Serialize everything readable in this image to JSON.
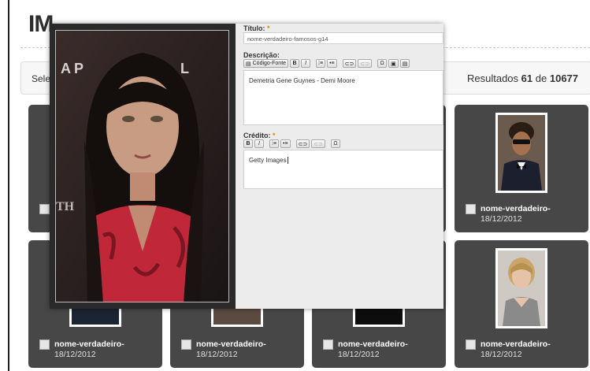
{
  "page": {
    "title": "IM",
    "select_label": "Sele",
    "results_prefix": "Resultados",
    "results_count": "61",
    "results_sep": "de",
    "results_total": "10677"
  },
  "cards": [
    {
      "name": "nome-verdadeiro-",
      "date": "18/12/2012",
      "photo": "man-with-sunglasses-bowtie"
    },
    {
      "name": "nome-verdadeiro-",
      "date": "18/12/2012",
      "photo": "blonde-woman"
    },
    {
      "name": "nome-verdadeiro-",
      "date": "18/12/2012",
      "photo": "dark"
    },
    {
      "name": "nome-verdadeiro-",
      "date": "18/12/2012",
      "photo": "person-hidden"
    },
    {
      "name": "nome-verdadeiro-",
      "date": "18/12/2012",
      "photo": "dark"
    },
    {
      "name": "nome-verdadeiro-",
      "date": "18/12/2012",
      "photo": "hidden"
    }
  ],
  "modal": {
    "titulo_label": "Título:",
    "titulo_req": "*",
    "titulo_value": "nome-verdadeiro-famosos-g14",
    "descricao_label": "Descrição:",
    "descricao_toolbar": [
      "Código-Fonte",
      "B",
      "I",
      "ol",
      "ul",
      "link",
      "unlink",
      "omega",
      "paste-text",
      "paste-word"
    ],
    "codigo_fonte_label": "Código-Fonte",
    "descricao_value": "Demetria Gene Guynes - Demi Moore",
    "credito_label": "Crédito:",
    "credito_req": "*",
    "credito_value": "Getty Images",
    "photo_subject": "woman-long-dark-hair-red-blouse"
  },
  "colors": {
    "card_bg": "#474747",
    "modal_bg": "#ececec",
    "required": "#e08a00"
  }
}
